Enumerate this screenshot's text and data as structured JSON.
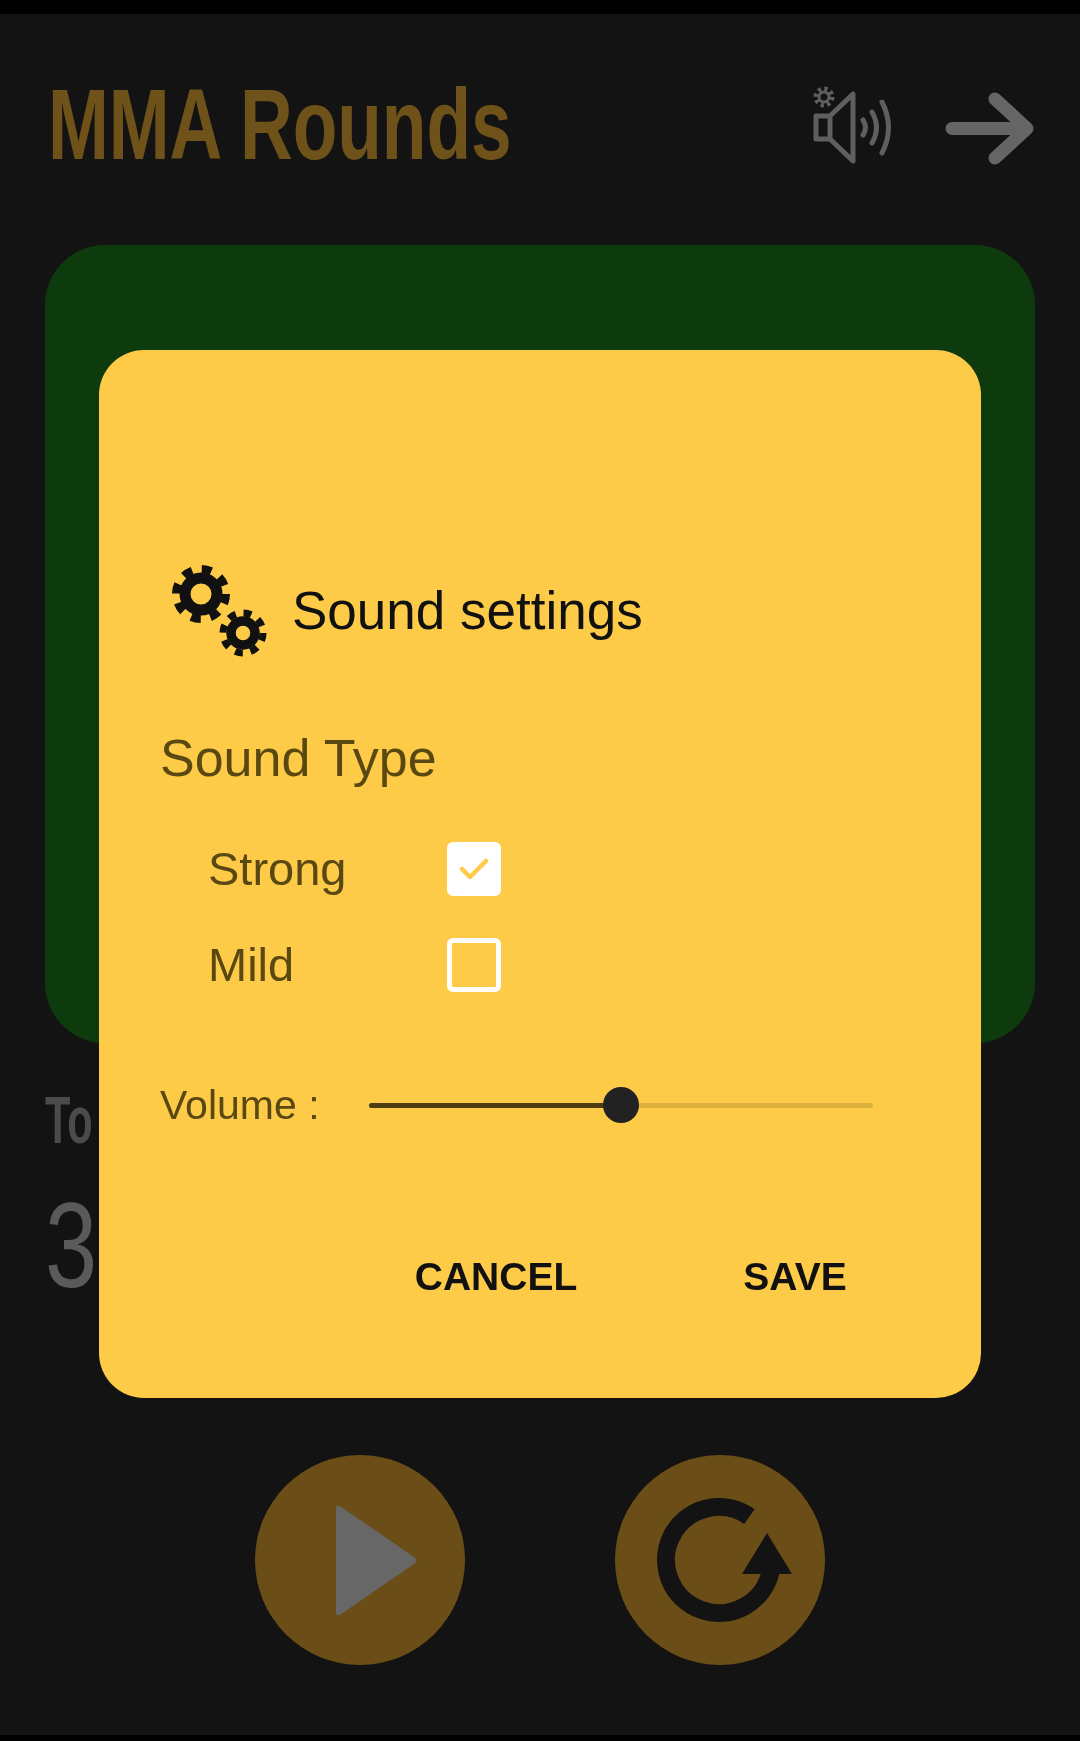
{
  "header": {
    "title": "MMA Rounds"
  },
  "stats": {
    "label": "To",
    "value": "3"
  },
  "dialog": {
    "title": "Sound settings",
    "section": "Sound Type",
    "options": [
      {
        "label": "Strong",
        "checked": true
      },
      {
        "label": "Mild",
        "checked": false
      }
    ],
    "volume": {
      "label": "Volume :",
      "level": 0.5
    },
    "buttons": [
      "CANCEL",
      "SAVE"
    ]
  }
}
